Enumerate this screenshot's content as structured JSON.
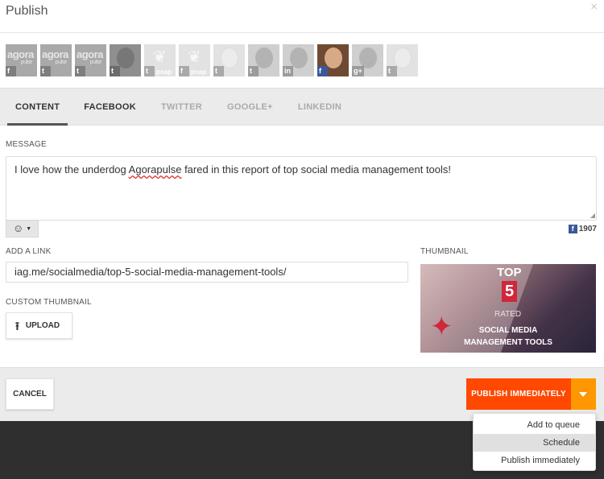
{
  "dialog": {
    "title": "Publish",
    "close_glyph": "×"
  },
  "profiles": [
    {
      "type": "brand",
      "brand": "agora",
      "sub": "pulse",
      "network": "f",
      "tone": "normal"
    },
    {
      "type": "brand",
      "brand": "agora",
      "sub": "pulse",
      "network": "t",
      "tone": "normal"
    },
    {
      "type": "brand",
      "brand": "agora",
      "sub": "pulse",
      "network": "t",
      "tone": "normal"
    },
    {
      "type": "face",
      "network": "t",
      "tone": "dark"
    },
    {
      "type": "feather",
      "network": "t",
      "extra": "pnap",
      "tone": "light"
    },
    {
      "type": "feather",
      "network": "f",
      "extra": "pnap",
      "tone": "light"
    },
    {
      "type": "face",
      "network": "t",
      "tone": "light"
    },
    {
      "type": "face",
      "network": "t",
      "tone": "mid"
    },
    {
      "type": "face",
      "network": "in",
      "tone": "mid"
    },
    {
      "type": "face",
      "network": "f",
      "tone": "selected"
    },
    {
      "type": "face",
      "network": "g+",
      "tone": "mid"
    },
    {
      "type": "face",
      "network": "t",
      "tone": "light"
    }
  ],
  "tabs": [
    {
      "label": "CONTENT",
      "state": "active"
    },
    {
      "label": "FACEBOOK",
      "state": "enabled"
    },
    {
      "label": "TWITTER",
      "state": "disabled"
    },
    {
      "label": "GOOGLE+",
      "state": "disabled"
    },
    {
      "label": "LINKEDIN",
      "state": "disabled"
    }
  ],
  "message": {
    "label": "MESSAGE",
    "text_before": "I love how the underdog ",
    "misspelled": "Agorapulse",
    "text_after": " fared in this report of top social media management tools!",
    "emoji_glyph": "☺",
    "char_counter": "1907",
    "counter_network": "f"
  },
  "link": {
    "label": "ADD A LINK",
    "value": "iag.me/socialmedia/top-5-social-media-management-tools/"
  },
  "custom_thumbnail": {
    "label": "CUSTOM THUMBNAIL",
    "upload_label": "UPLOAD"
  },
  "thumbnail": {
    "label": "THUMBNAIL",
    "line1": "TOP",
    "number": "5",
    "line2": "RATED",
    "line3": "SOCIAL MEDIA",
    "line4": "MANAGEMENT TOOLS"
  },
  "footer": {
    "cancel_label": "CANCEL",
    "publish_label": "PUBLISH IMMEDIATELY"
  },
  "dropdown": {
    "items": [
      "Add to queue",
      "Schedule",
      "Publish immediately"
    ],
    "highlighted_index": 1
  },
  "colors": {
    "publish": "#ff4800",
    "publish_caret": "#ff9800",
    "facebook": "#3b5998"
  }
}
